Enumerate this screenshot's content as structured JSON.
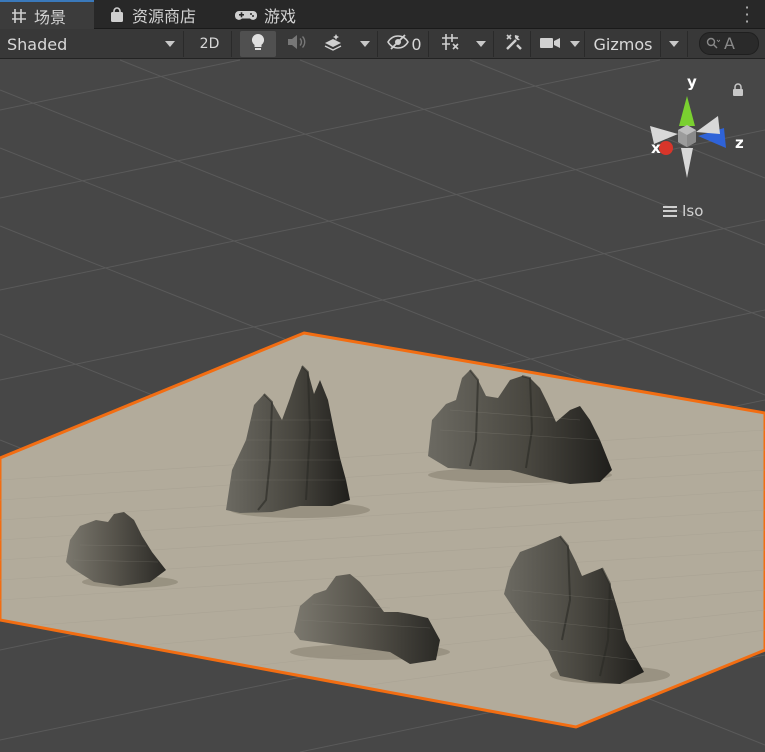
{
  "tabs": [
    {
      "label": "场景",
      "icon": "grid-icon",
      "active": true
    },
    {
      "label": "资源商店",
      "icon": "shopping-bag-icon",
      "active": false
    },
    {
      "label": "游戏",
      "icon": "gamepad-icon",
      "active": false
    }
  ],
  "toolbar": {
    "shading_mode": "Shaded",
    "mode_2d_label": "2D",
    "hidden_count": "0",
    "gizmos_label": "Gizmos",
    "search_placeholder": "A"
  },
  "gizmo": {
    "axis_y": "y",
    "axis_x": "x",
    "axis_z": "z",
    "projection_label": "Iso",
    "colors": {
      "x": "#d8352a",
      "y": "#7ad030",
      "z": "#2f63d8"
    }
  },
  "scene": {
    "terrain_color": "#b2ab9b",
    "selection_outline": "#f26d12",
    "grid_color": "#5a5a5a",
    "background": "#474747"
  }
}
